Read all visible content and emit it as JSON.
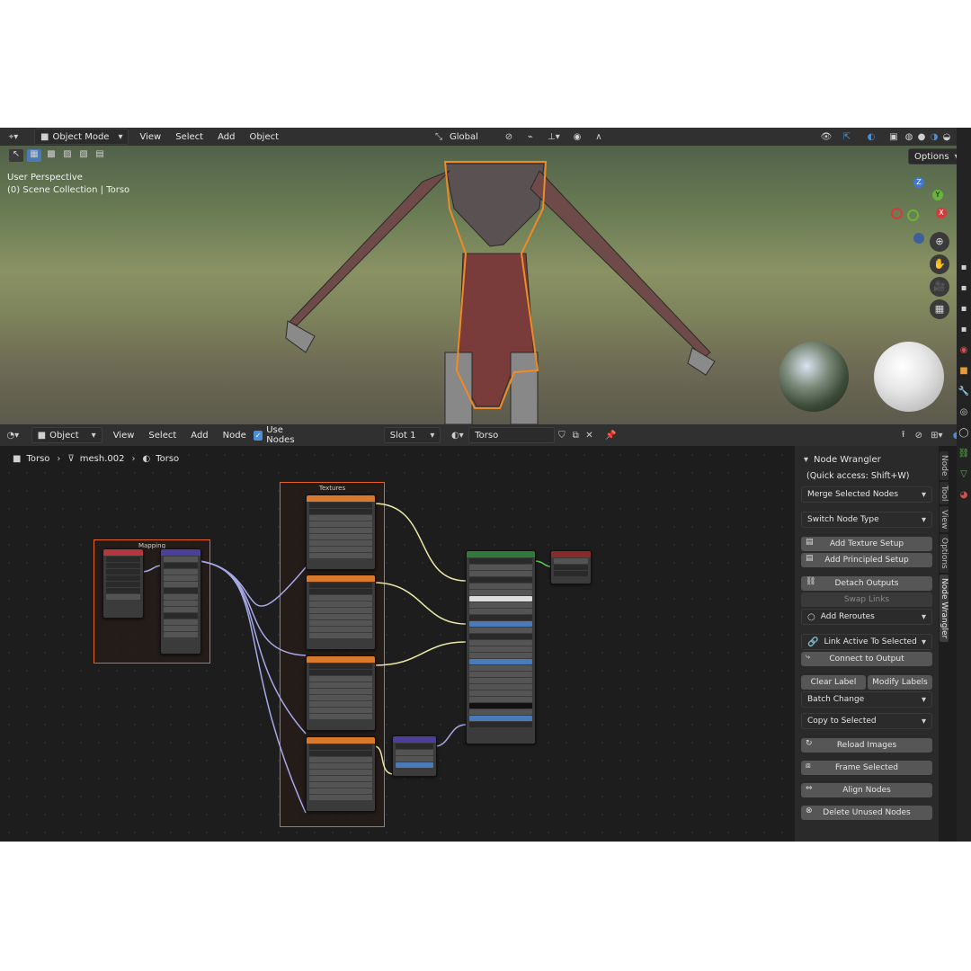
{
  "viewport_header": {
    "mode": "Object Mode",
    "menus": [
      "View",
      "Select",
      "Add",
      "Object"
    ],
    "transform_orientation": "Global",
    "options_label": "Options"
  },
  "viewport": {
    "perspective": "User Perspective",
    "collection": "(0) Scene Collection | Torso",
    "gizmo": {
      "z": "Z",
      "y": "Y",
      "x": "X"
    }
  },
  "node_header": {
    "mode": "Object",
    "menus": [
      "View",
      "Select",
      "Add",
      "Node"
    ],
    "use_nodes_label": "Use Nodes",
    "slot": "Slot 1",
    "material": "Torso"
  },
  "breadcrumb": {
    "object": "Torso",
    "mesh": "mesh.002",
    "material": "Torso"
  },
  "frames": {
    "mapping": "Mapping",
    "textures": "Textures"
  },
  "sidepanel": {
    "title": "Node Wrangler",
    "quick_access": "(Quick access: Shift+W)",
    "merge": "Merge Selected Nodes",
    "switch": "Switch Node Type",
    "add_texture": "Add Texture Setup",
    "add_principled": "Add Principled Setup",
    "detach": "Detach Outputs",
    "swap": "Swap Links",
    "reroutes": "Add Reroutes",
    "link_active": "Link Active To Selected",
    "connect_output": "Connect to Output",
    "clear_label": "Clear Label",
    "modify_labels": "Modify Labels",
    "batch": "Batch Change",
    "copy_selected": "Copy to Selected",
    "reload": "Reload Images",
    "frame_selected": "Frame Selected",
    "align": "Align Nodes",
    "delete_unused": "Delete Unused Nodes"
  },
  "right_tabs": [
    "Node",
    "Tool",
    "View",
    "Options",
    "Node Wrangler"
  ],
  "colors": {
    "frame": "#e8641b",
    "header_bg": "#303030",
    "texture_node": "#e07a2a",
    "principled_node": "#2f7a3a",
    "output_node": "#8a2b2b",
    "vector_node": "#4b3f9b",
    "wire_yellow": "#e9e9a8",
    "wire_purple": "#a8a8e8",
    "button": "#565656"
  }
}
